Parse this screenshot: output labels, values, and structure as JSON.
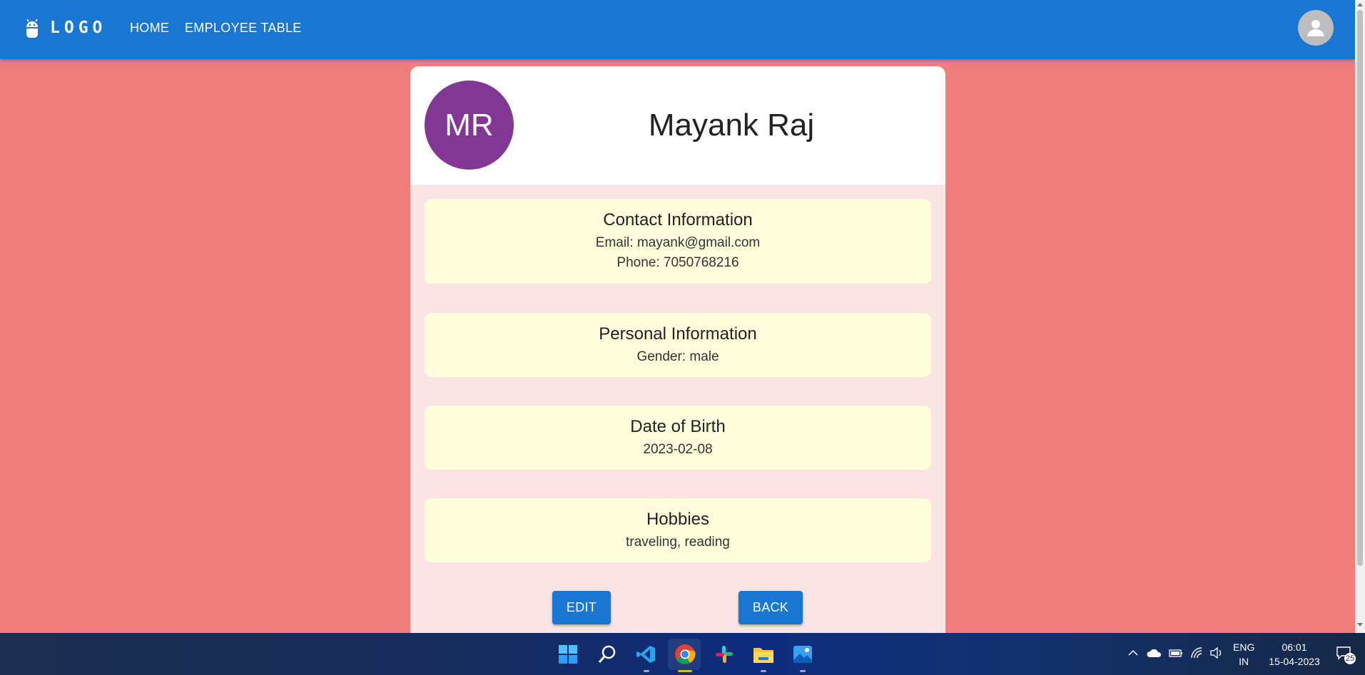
{
  "appbar": {
    "logo_text": "LOGO",
    "nav": [
      "HOME",
      "EMPLOYEE TABLE"
    ],
    "account_icon": "account-circle-icon"
  },
  "profile": {
    "initials": "MR",
    "name": "Mayank Raj",
    "avatar_color": "#833795"
  },
  "sections": {
    "contact": {
      "title": "Contact Information",
      "email": "Email: mayank@gmail.com",
      "phone": "Phone: 7050768216"
    },
    "personal": {
      "title": "Personal Information",
      "gender": "Gender: male"
    },
    "dob": {
      "title": "Date of Birth",
      "value": "2023-02-08"
    },
    "hobbies": {
      "title": "Hobbies",
      "value": "traveling, reading"
    }
  },
  "actions": {
    "edit": "EDIT",
    "back": "BACK"
  },
  "taskbar": {
    "apps": [
      "windows-start-icon",
      "search-icon",
      "vscode-icon",
      "chrome-icon",
      "slack-icon",
      "file-explorer-icon",
      "photos-icon"
    ],
    "language": "ENG",
    "region": "IN",
    "time": "06:01",
    "date": "15-04-2023",
    "notifications": "25"
  },
  "colors": {
    "background": "#f07d7b",
    "appbar": "#1976d2",
    "card": "#fae4e4",
    "section": "#fefedd",
    "button": "#1976d2"
  }
}
